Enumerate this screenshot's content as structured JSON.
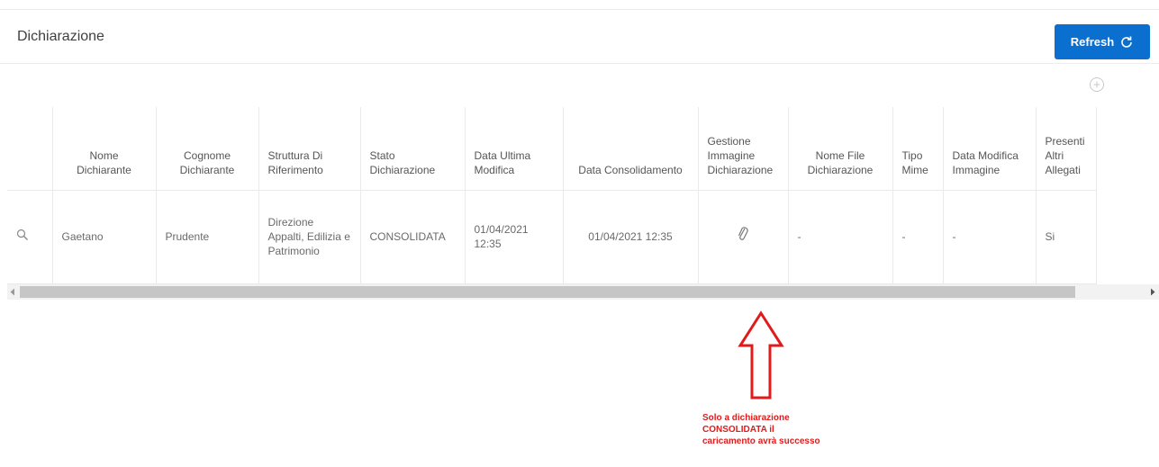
{
  "header": {
    "title": "Dichiarazione",
    "refresh_label": "Refresh"
  },
  "table": {
    "columns": [
      "",
      "Nome Dichiarante",
      "Cognome Dichiarante",
      "Struttura Di Riferimento",
      "Stato Dichiarazione",
      "Data Ultima Modifica",
      "Data Consolidamento",
      "Gestione Immagine Dichiarazione",
      "Nome File Dichiarazione",
      "Tipo Mime",
      "Data Modifica Immagine",
      "Presenti Altri Allegati"
    ],
    "rows": [
      {
        "nome": "Gaetano",
        "cognome": "Prudente",
        "struttura": "Direzione Appalti, Edilizia e Patrimonio",
        "stato": "CONSOLIDATA",
        "data_ultima_modifica": "01/04/2021 12:35",
        "data_consolidamento": "01/04/2021 12:35",
        "nome_file": "-",
        "tipo_mime": "-",
        "data_modifica_immagine": "-",
        "altri_allegati": "Si"
      }
    ]
  },
  "annotation": {
    "note": "Solo a dichiarazione CONSOLIDATA il caricamento avrà successo",
    "color": "#e11b1b"
  },
  "colors": {
    "accent": "#0b6fd0"
  },
  "icons": {
    "refresh": "refresh-icon",
    "add": "plus-circle-icon",
    "search": "search-icon",
    "attachment": "paperclip-icon"
  }
}
